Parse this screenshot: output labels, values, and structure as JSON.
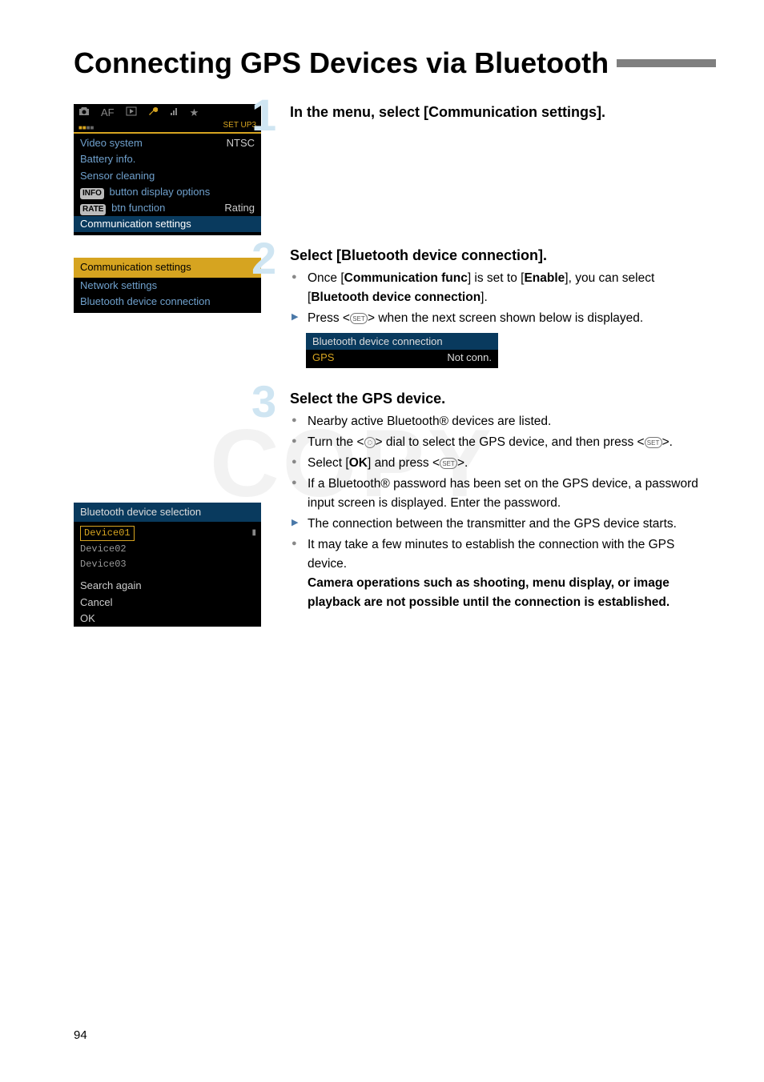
{
  "page": {
    "title": "Connecting GPS Devices via Bluetooth",
    "number": "94",
    "watermark": "COPY"
  },
  "screens": {
    "setup": {
      "tab_label": "SET UP3",
      "tab_af": "AF",
      "rows": [
        {
          "label": "Video system",
          "value": "NTSC"
        },
        {
          "label": "Battery info."
        },
        {
          "label": "Sensor cleaning"
        },
        {
          "label_pre_badge": "INFO",
          "label": " button display options"
        },
        {
          "label_pre_badge": "RATE",
          "label": " btn function",
          "value": "Rating"
        },
        {
          "label": "Communication settings",
          "highlight": true
        }
      ]
    },
    "comm": {
      "header": "Communication settings",
      "items": [
        "Network settings",
        "Bluetooth device connection"
      ]
    },
    "bt_conn": {
      "header": "Bluetooth device connection",
      "row": {
        "label": "GPS",
        "value": "Not conn."
      }
    },
    "bt_select": {
      "header": "Bluetooth device selection",
      "selected": "Device01",
      "others": [
        "Device02",
        "Device03"
      ],
      "footer": [
        "Search again",
        "Cancel",
        "OK"
      ]
    }
  },
  "steps": {
    "s1": {
      "num": "1",
      "heading": "In the menu, select [Communication settings]."
    },
    "s2": {
      "num": "2",
      "heading": "Select [Bluetooth device connection].",
      "b1_pre": "Once [",
      "b1_bold1": "Communication func",
      "b1_mid": "] is set to [",
      "b1_bold2": "Enable",
      "b1_post1": "], you can select [",
      "b1_bold3": "Bluetooth device connection",
      "b1_post2": "].",
      "b2_pre": "Press <",
      "b2_post": "> when the next screen shown below is displayed."
    },
    "s3": {
      "num": "3",
      "heading": "Select the GPS device.",
      "b1": "Nearby active Bluetooth® devices are listed.",
      "b2_pre": "Turn the <",
      "b2_mid": "> dial to select the GPS device, and then press <",
      "b2_post": ">.",
      "b3_pre": "Select [",
      "b3_bold": "OK",
      "b3_mid": "] and press <",
      "b3_post": ">.",
      "b4": "If a Bluetooth® password has been set on the GPS device, a password input screen is displayed. Enter the password.",
      "b5": "The connection between the transmitter and the GPS device starts.",
      "b6_plain": "It may take a few minutes to establish the connection with the GPS device.",
      "b6_bold": "Camera operations such as shooting, menu display, or image playback are not possible until the connection is established."
    }
  }
}
